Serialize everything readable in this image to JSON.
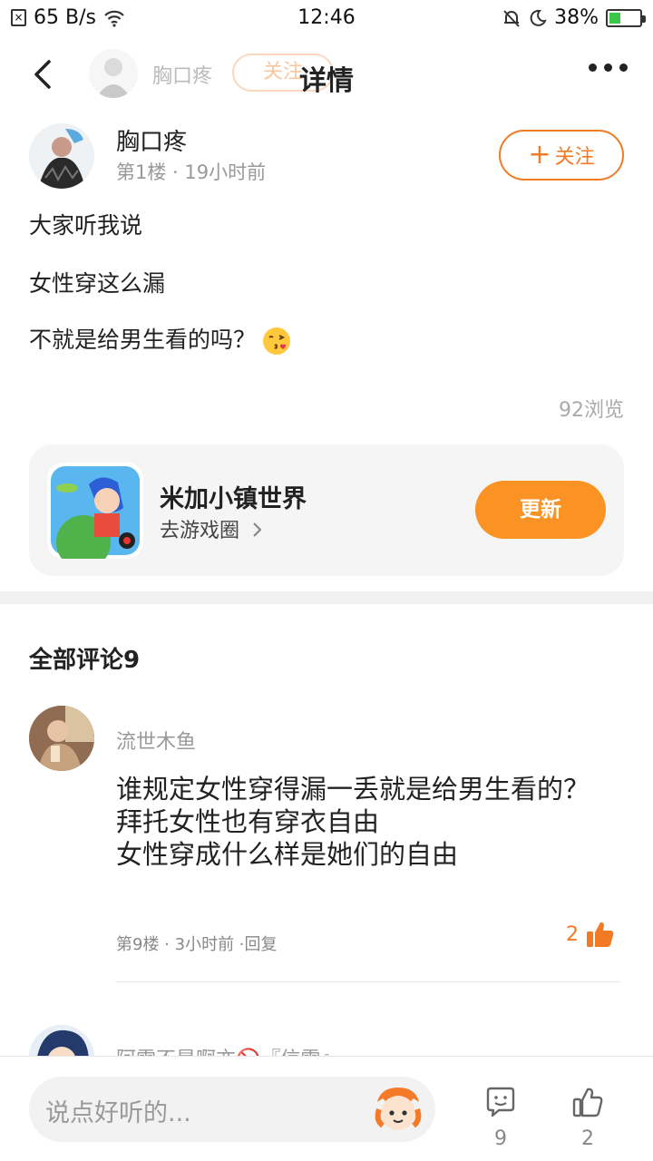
{
  "status": {
    "net_speed": "65 B/s",
    "time": "12:46",
    "battery": "38%",
    "battery_level": 0.38
  },
  "nav": {
    "author_name": "胸口疼",
    "follow_label": "关注",
    "title": "详情"
  },
  "post": {
    "author": "胸口疼",
    "meta": "第1楼 · 19小时前",
    "follow_label": "关注",
    "lines": [
      "大家听我说",
      "女性穿这么漏",
      "不就是给男生看的吗？"
    ],
    "views": "92浏览"
  },
  "game": {
    "name": "米加小镇世界",
    "link": "去游戏圈",
    "button": "更新"
  },
  "comments": {
    "title": "全部评论9",
    "items": [
      {
        "author": "流世木鱼",
        "text": "谁规定女性穿得漏一丢就是给男生看的？\n拜托女性也有穿衣自由\n女性穿成什么样是她们的自由",
        "meta": "第9楼 · 3小时前 ·回复",
        "likes": "2"
      },
      {
        "author": "阿雷不是啊亦🚫『信雷』"
      }
    ]
  },
  "bottom": {
    "placeholder": "说点好听的...",
    "comment_count": "9",
    "like_count": "2"
  },
  "colors": {
    "accent": "#f37a25",
    "update_button": "#fb9324"
  }
}
